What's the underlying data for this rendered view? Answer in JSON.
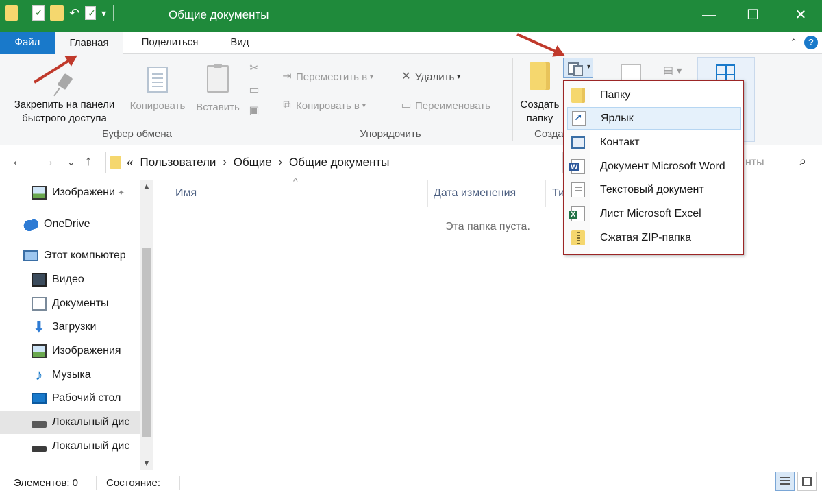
{
  "window": {
    "title": "Общие документы",
    "controls": {
      "minimize": "—",
      "maximize": "☐",
      "close": "✕"
    }
  },
  "qat": {
    "undo_glyph": "↶",
    "dropdown_glyph": "▾"
  },
  "ribbon_tabs": {
    "file": "Файл",
    "home": "Главная",
    "share": "Поделиться",
    "view": "Вид",
    "collapse_glyph": "⌃",
    "help_glyph": "?"
  },
  "ribbon": {
    "clipboard": {
      "pin_label_1": "Закрепить на панели",
      "pin_label_2": "быстрого доступа",
      "copy": "Копировать",
      "paste": "Вставить",
      "group_label": "Буфер обмена"
    },
    "organize": {
      "move_to": "Переместить в",
      "copy_to": "Копировать в",
      "delete": "Удалить",
      "rename": "Переименовать",
      "group_label": "Упорядочить"
    },
    "create": {
      "new_folder_1": "Создать",
      "new_folder_2": "папку",
      "group_label_partial": "Созда"
    }
  },
  "new_item_menu": {
    "items": [
      {
        "label": "Папку",
        "icon": "folder-icon"
      },
      {
        "label": "Ярлык",
        "icon": "shortcut-icon"
      },
      {
        "label": "Контакт",
        "icon": "contact-icon"
      },
      {
        "label": "Документ Microsoft Word",
        "icon": "word-document-icon"
      },
      {
        "label": "Текстовый документ",
        "icon": "text-document-icon"
      },
      {
        "label": "Лист Microsoft Excel",
        "icon": "excel-sheet-icon"
      },
      {
        "label": "Сжатая ZIP-папка",
        "icon": "zip-folder-icon"
      }
    ],
    "hovered_index": 1
  },
  "address_bar": {
    "overflow": "«",
    "crumbs": [
      "Пользователи",
      "Общие",
      "Общие документы"
    ],
    "separator": "›"
  },
  "search": {
    "placeholder_fragment": "нты",
    "icon": "search-icon"
  },
  "nav": {
    "back": "←",
    "forward": "→",
    "recent": "⌄",
    "up": "↑"
  },
  "nav_pane": {
    "items": [
      {
        "label": "Изображени",
        "icon": "pictures-icon",
        "pinned": "📌"
      },
      {
        "label": "OneDrive",
        "icon": "onedrive-icon"
      },
      {
        "label": "Этот компьютер",
        "icon": "computer-icon"
      },
      {
        "label": "Видео",
        "icon": "video-icon"
      },
      {
        "label": "Документы",
        "icon": "documents-icon"
      },
      {
        "label": "Загрузки",
        "icon": "downloads-icon"
      },
      {
        "label": "Изображения",
        "icon": "pictures-icon"
      },
      {
        "label": "Музыка",
        "icon": "music-icon"
      },
      {
        "label": "Рабочий стол",
        "icon": "desktop-icon"
      },
      {
        "label": "Локальный дис",
        "icon": "local-disk-icon"
      },
      {
        "label": "Локальный дис",
        "icon": "local-disk-icon"
      }
    ],
    "highlighted_index": 9
  },
  "content": {
    "columns": {
      "name": "Имя",
      "date": "Дата изменения",
      "type_partial": "Ти"
    },
    "sort_glyph": "^",
    "empty_message": "Эта папка пуста."
  },
  "status_bar": {
    "items_count": "Элементов: 0",
    "state": "Состояние:"
  },
  "colors": {
    "titlebar": "#1f8a3b",
    "file_tab": "#1979ca",
    "annotation_arrow": "#c0392b",
    "menu_border": "#9c2626"
  }
}
